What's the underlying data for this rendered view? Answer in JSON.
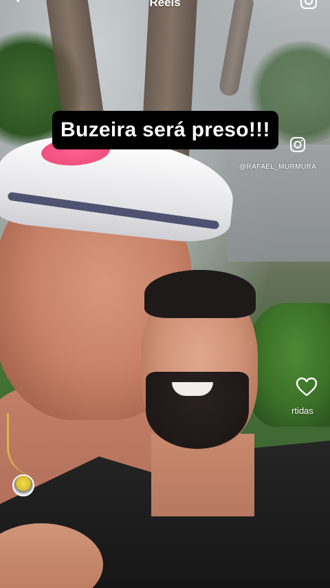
{
  "top_bar": {
    "title": "Reels",
    "back_icon": "chevron-left-icon",
    "camera_icon": "camera-icon"
  },
  "video": {
    "caption": "Buzeira será preso!!!",
    "watermark_icon": "instagram-icon",
    "watermark_handle": "@RAFAEL_MURMURA"
  },
  "actions": {
    "like_icon": "heart-outline-icon",
    "partial_label": "rtidas"
  },
  "author": {
    "avatar_icon": "avatar"
  },
  "colors": {
    "caption_bg": "#000000",
    "caption_text": "#ffffff",
    "icon": "#ffffff"
  }
}
